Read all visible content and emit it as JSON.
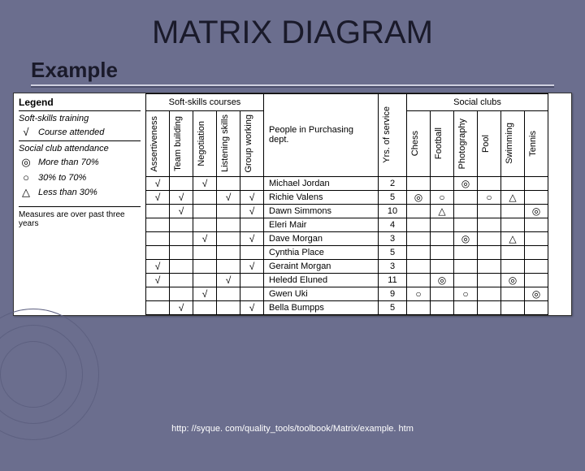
{
  "title": "MATRIX DIAGRAM",
  "subtitle": "Example",
  "footer": "http: //syque. com/quality_tools/toolbook/Matrix/example. htm",
  "legend": {
    "heading": "Legend",
    "sect1_title": "Soft-skills training",
    "chk": "√",
    "chk_label": "Course attended",
    "sect2_title": "Social club attendance",
    "lvl1_sym": "◎",
    "lvl1_label": "More than 70%",
    "lvl2_sym": "○",
    "lvl2_label": "30% to 70%",
    "lvl3_sym": "△",
    "lvl3_label": "Less than 30%",
    "note": "Measures are over past three years"
  },
  "headers": {
    "soft_group": "Soft-skills courses",
    "clubs_group": "Social clubs",
    "people_group": "People in Purchasing dept.",
    "yrs": "Yrs. of service",
    "soft": [
      "Assertiveness",
      "Team building",
      "Negotiation",
      "Listening skills",
      "Group working"
    ],
    "clubs": [
      "Chess",
      "Football",
      "Photography",
      "Pool",
      "Swimming",
      "Tennis"
    ]
  },
  "chart_data": {
    "type": "table",
    "rows": [
      {
        "name": "Michael Jordan",
        "soft": [
          "√",
          "",
          "√",
          "",
          ""
        ],
        "yrs": 2,
        "clubs": [
          "",
          "",
          "◎",
          "",
          "",
          ""
        ]
      },
      {
        "name": "Richie Valens",
        "soft": [
          "√",
          "√",
          "",
          "√",
          "√"
        ],
        "yrs": 5,
        "clubs": [
          "◎",
          "○",
          "",
          "○",
          "△",
          ""
        ]
      },
      {
        "name": "Dawn Simmons",
        "soft": [
          "",
          "√",
          "",
          "",
          "√"
        ],
        "yrs": 10,
        "clubs": [
          "",
          "△",
          "",
          "",
          "",
          "◎"
        ]
      },
      {
        "name": "Eleri Mair",
        "soft": [
          "",
          "",
          "",
          "",
          ""
        ],
        "yrs": 4,
        "clubs": [
          "",
          "",
          "",
          "",
          "",
          ""
        ]
      },
      {
        "name": "Dave Morgan",
        "soft": [
          "",
          "",
          "√",
          "",
          "√"
        ],
        "yrs": 3,
        "clubs": [
          "",
          "",
          "◎",
          "",
          "△",
          ""
        ]
      },
      {
        "name": "Cynthia Place",
        "soft": [
          "",
          "",
          "",
          "",
          ""
        ],
        "yrs": 5,
        "clubs": [
          "",
          "",
          "",
          "",
          "",
          ""
        ]
      },
      {
        "name": "Geraint Morgan",
        "soft": [
          "√",
          "",
          "",
          "",
          "√"
        ],
        "yrs": 3,
        "clubs": [
          "",
          "",
          "",
          "",
          "",
          ""
        ]
      },
      {
        "name": "Heledd Eluned",
        "soft": [
          "√",
          "",
          "",
          "√",
          ""
        ],
        "yrs": 11,
        "clubs": [
          "",
          "◎",
          "",
          "",
          "◎",
          ""
        ]
      },
      {
        "name": "Gwen Uki",
        "soft": [
          "",
          "",
          "√",
          "",
          ""
        ],
        "yrs": 9,
        "clubs": [
          "○",
          "",
          "○",
          "",
          "",
          "◎"
        ]
      },
      {
        "name": "Bella Bumpps",
        "soft": [
          "",
          "√",
          "",
          "",
          "√"
        ],
        "yrs": 5,
        "clubs": [
          "",
          "",
          "",
          "",
          "",
          ""
        ]
      }
    ]
  }
}
